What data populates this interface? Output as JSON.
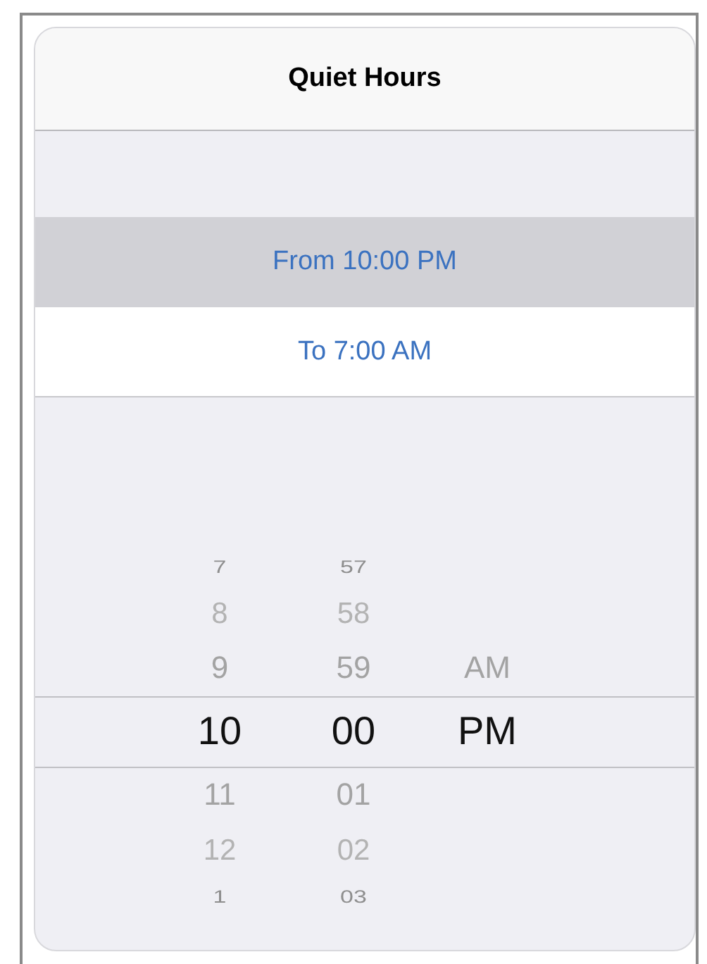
{
  "header": {
    "title": "Quiet Hours"
  },
  "time_rows": [
    {
      "label": "From 10:00 PM",
      "selected": true
    },
    {
      "label": "To 7:00 AM",
      "selected": false
    }
  ],
  "picker": {
    "columns": [
      {
        "items": [
          {
            "label": "7",
            "selected": false
          },
          {
            "label": "8",
            "selected": false
          },
          {
            "label": "9",
            "selected": false
          },
          {
            "label": "10",
            "selected": true
          },
          {
            "label": "11",
            "selected": false
          },
          {
            "label": "12",
            "selected": false
          },
          {
            "label": "1",
            "selected": false
          }
        ]
      },
      {
        "items": [
          {
            "label": "57",
            "selected": false
          },
          {
            "label": "58",
            "selected": false
          },
          {
            "label": "59",
            "selected": false
          },
          {
            "label": "00",
            "selected": true
          },
          {
            "label": "01",
            "selected": false
          },
          {
            "label": "02",
            "selected": false
          },
          {
            "label": "03",
            "selected": false
          }
        ]
      },
      {
        "items": [
          {
            "label": "AM",
            "selected": false
          },
          {
            "label": "PM",
            "selected": true
          }
        ]
      }
    ]
  }
}
